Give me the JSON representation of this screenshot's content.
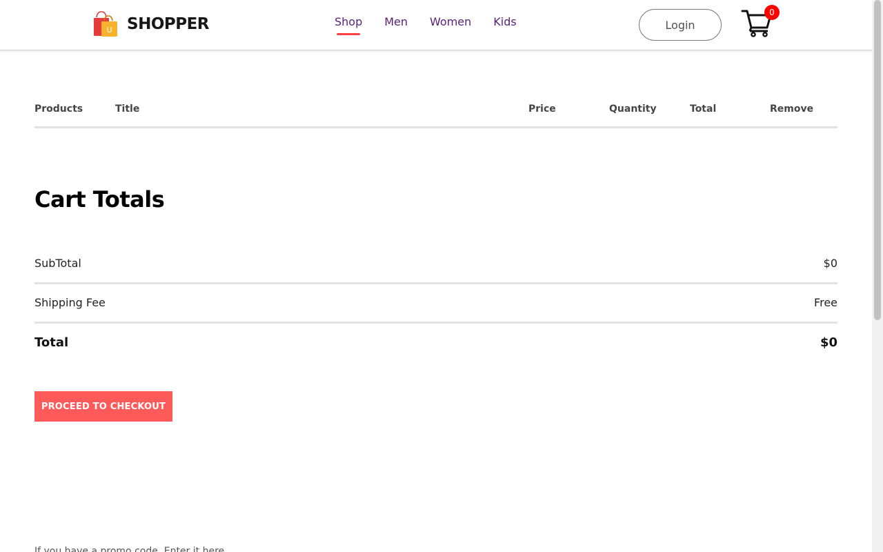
{
  "header": {
    "brand": "SHOPPER",
    "nav": [
      {
        "label": "Shop",
        "active": true
      },
      {
        "label": "Men",
        "active": false
      },
      {
        "label": "Women",
        "active": false
      },
      {
        "label": "Kids",
        "active": false
      }
    ],
    "login_label": "Login",
    "cart_count": "0"
  },
  "cart_table": {
    "columns": [
      "Products",
      "Title",
      "Price",
      "Quantity",
      "Total",
      "Remove"
    ]
  },
  "totals": {
    "title": "Cart Totals",
    "subtotal_label": "SubTotal",
    "subtotal_value": "$0",
    "shipping_label": "Shipping Fee",
    "shipping_value": "Free",
    "total_label": "Total",
    "total_value": "$0",
    "checkout_label": "PROCEED TO CHECKOUT"
  },
  "promo": {
    "prompt": "If you have a promo code, Enter it here"
  },
  "colors": {
    "accent": "#ff5a5a",
    "nav_active_underline": "#ff4141",
    "badge": "#ff0000"
  }
}
